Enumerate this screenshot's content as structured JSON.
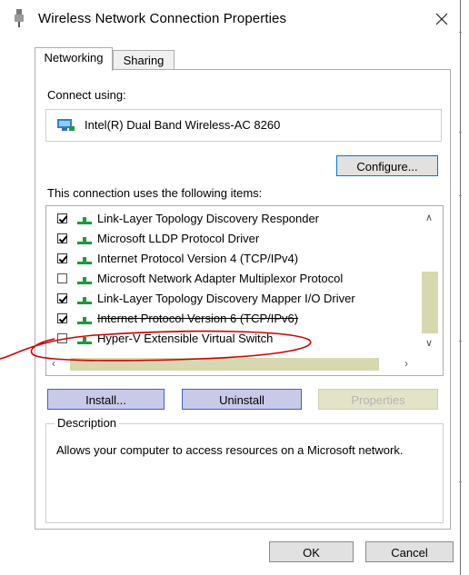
{
  "window": {
    "title": "Wireless Network Connection Properties",
    "close_glyph": "✕"
  },
  "tabs": [
    {
      "label": "Networking",
      "active": true
    },
    {
      "label": "Sharing",
      "active": false
    }
  ],
  "connect": {
    "label": "Connect using:",
    "adapter": "Intel(R) Dual Band Wireless-AC 8260",
    "configure_label": "Configure..."
  },
  "items_label": "This connection uses the following items:",
  "items": [
    {
      "label": "Link-Layer Topology Discovery Responder",
      "checked": true
    },
    {
      "label": "Microsoft LLDP Protocol Driver",
      "checked": true
    },
    {
      "label": "Internet Protocol Version 4 (TCP/IPv4)",
      "checked": true
    },
    {
      "label": "Microsoft Network Adapter Multiplexor Protocol",
      "checked": false
    },
    {
      "label": "Link-Layer Topology Discovery Mapper I/O Driver",
      "checked": true
    },
    {
      "label": "Internet Protocol Version 6 (TCP/IPv6)",
      "checked": true
    },
    {
      "label": "Hyper-V Extensible Virtual Switch",
      "checked": false
    }
  ],
  "actions": {
    "install": "Install...",
    "uninstall": "Uninstall",
    "properties": "Properties"
  },
  "description": {
    "legend": "Description",
    "text": "Allows your computer to access resources on a Microsoft network."
  },
  "footer": {
    "ok": "OK",
    "cancel": "Cancel"
  },
  "colors": {
    "annotation": "#d00000",
    "network_icon": "#1a9a3a",
    "scroll_thumb": "#d8d8b0"
  }
}
